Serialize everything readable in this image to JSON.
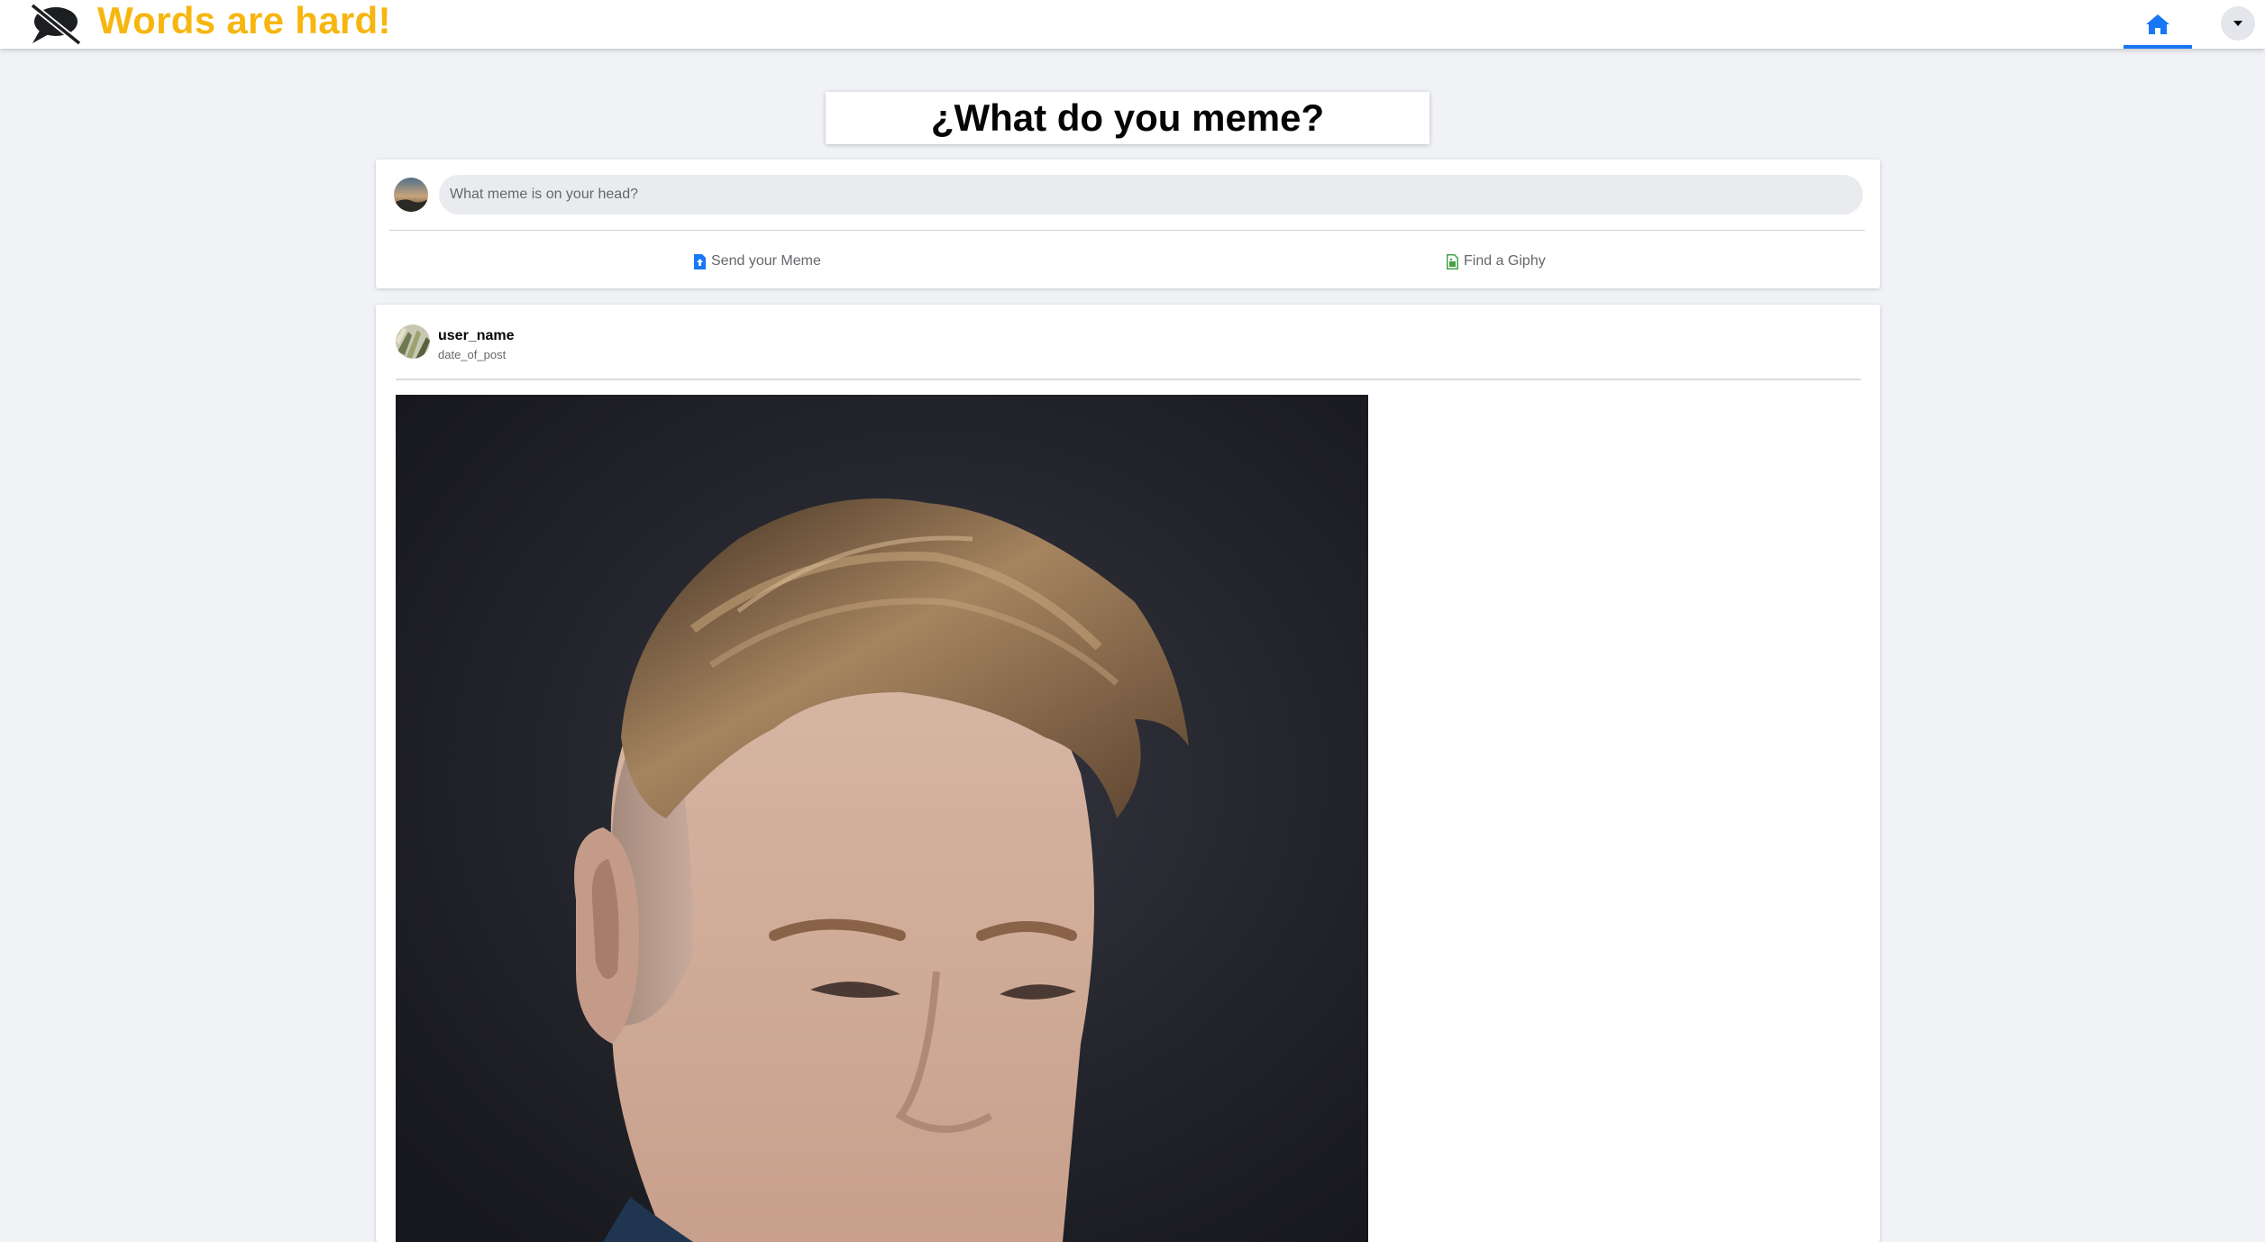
{
  "app": {
    "brand_name": "Words are hard!",
    "brand_color": "#f7b60f",
    "logo_icon": "no-speech-bubble-icon"
  },
  "navbar": {
    "home_icon": "home-icon",
    "menu_icon": "caret-down-icon",
    "accent_color": "#1877f2"
  },
  "heading": {
    "title": "¿What do you meme?"
  },
  "composer": {
    "placeholder": "What meme is on your head?",
    "value": "",
    "send_label": "Send your Meme",
    "send_icon": "file-upload-icon",
    "giphy_label": "Find a Giphy",
    "giphy_icon": "file-image-icon"
  },
  "post": {
    "user_name": "user_name",
    "date": "date_of_post",
    "image_alt": "Portrait of a young man with swept-back undercut hair against a dark background"
  }
}
